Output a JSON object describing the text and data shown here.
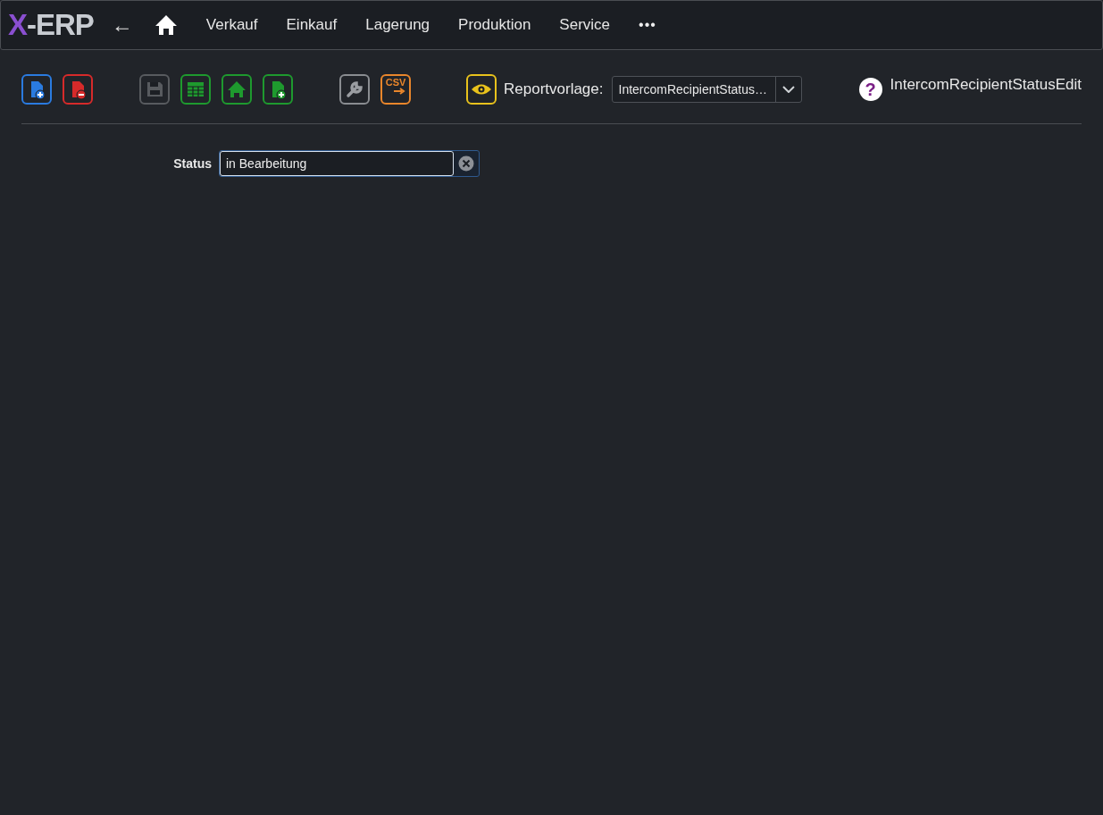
{
  "logo": {
    "accent": "X",
    "rest": "-ERP"
  },
  "nav": {
    "back": "←",
    "items": [
      "Verkauf",
      "Einkauf",
      "Lagerung",
      "Produktion",
      "Service"
    ],
    "more": "•••"
  },
  "toolbar": {
    "groups": [
      [
        {
          "kind": "new"
        },
        {
          "kind": "delete"
        }
      ],
      [
        {
          "kind": "save",
          "disabled": true
        },
        {
          "kind": "table"
        },
        {
          "kind": "home"
        },
        {
          "kind": "add"
        }
      ],
      [
        {
          "kind": "tools"
        },
        {
          "kind": "csv",
          "label": "CSV"
        }
      ]
    ],
    "report": {
      "label": "Reportvorlage:",
      "value": "IntercomRecipientStatus…"
    },
    "help": "?",
    "page_title": "IntercomRecipientStatusEdit"
  },
  "form": {
    "fields": [
      {
        "label": "Status",
        "value": "in Bearbeitung",
        "focused": true
      }
    ]
  }
}
